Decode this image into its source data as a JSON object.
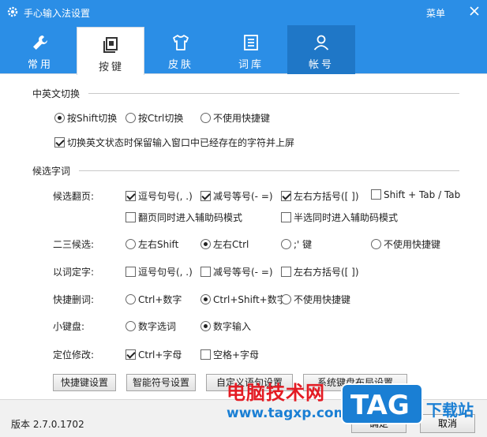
{
  "window": {
    "title": "手心输入法设置",
    "menu_label": "菜单"
  },
  "tabs": [
    {
      "label": "常用",
      "icon": "wrench-icon"
    },
    {
      "label": "按键",
      "icon": "keyboard-key-icon"
    },
    {
      "label": "皮肤",
      "icon": "tshirt-icon"
    },
    {
      "label": "词库",
      "icon": "document-icon"
    },
    {
      "label": "帐号",
      "icon": "user-icon"
    }
  ],
  "active_tab": "按键",
  "sections": {
    "switch": {
      "title": "中英文切换",
      "options": [
        "按Shift切换",
        "按Ctrl切换",
        "不使用快捷键"
      ],
      "selected": "按Shift切换",
      "keep_text_label": "切换英文状态时保留输入窗口中已经存在的字符并上屏",
      "keep_text_checked": true
    },
    "candidates": {
      "title": "候选字词",
      "paging": {
        "label": "候选翻页:",
        "options": [
          {
            "label": "逗号句号(, .)",
            "checked": true
          },
          {
            "label": "减号等号(- =)",
            "checked": true
          },
          {
            "label": "左右方括号([ ])",
            "checked": true
          },
          {
            "label": "Shift + Tab / Tab",
            "checked": false
          },
          {
            "label": "翻页同时进入辅助码模式",
            "checked": false
          },
          {
            "label": "半选同时进入辅助码模式",
            "checked": false
          }
        ]
      },
      "second": {
        "label": "二三候选:",
        "options": [
          "左右Shift",
          "左右Ctrl",
          ";' 键",
          "不使用快捷键"
        ],
        "selected": "左右Ctrl"
      },
      "word_to_char": {
        "label": "以词定字:",
        "options": [
          {
            "label": "逗号句号(, .)",
            "checked": false
          },
          {
            "label": "减号等号(- =)",
            "checked": false
          },
          {
            "label": "左右方括号([ ])",
            "checked": false
          }
        ]
      },
      "delete_word": {
        "label": "快捷删词:",
        "options": [
          "Ctrl+数字",
          "Ctrl+Shift+数字",
          "不使用快捷键"
        ],
        "selected": "Ctrl+Shift+数字"
      },
      "keypad": {
        "label": "小键盘:",
        "options": [
          "数字选词",
          "数字输入"
        ],
        "selected": "数字输入"
      },
      "locate": {
        "label": "定位修改:",
        "options": [
          {
            "label": "Ctrl+字母",
            "checked": true
          },
          {
            "label": "空格+字母",
            "checked": false
          }
        ]
      }
    }
  },
  "buttons": {
    "hotkey": "快捷键设置",
    "symbol": "智能符号设置",
    "custom": "自定义语句设置",
    "layout": "系统键盘布局设置"
  },
  "footer": {
    "version": "版本 2.7.0.1702",
    "ok": "确定",
    "cancel": "取消"
  },
  "watermark": {
    "site_name": "电脑技术网",
    "site_url": "www.tagxp.com",
    "tag": "TAG",
    "download": "下载站"
  },
  "colors": {
    "accent": "#2b8ee6",
    "tab_hover": "#1f77c7",
    "watermark_red": "#e31b23",
    "watermark_blue": "#1a7fd4"
  }
}
